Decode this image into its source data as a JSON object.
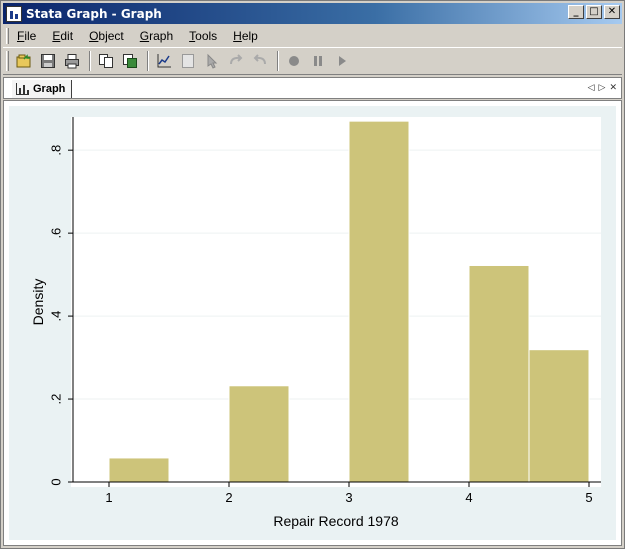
{
  "window": {
    "title": "Stata Graph - Graph",
    "buttons": {
      "minimize": "_",
      "maximize": "□",
      "close": "✕"
    }
  },
  "menu": {
    "items": [
      "File",
      "Edit",
      "Object",
      "Graph",
      "Tools",
      "Help"
    ]
  },
  "toolbar": {
    "icons": [
      "open-icon",
      "save-icon",
      "print-icon",
      "copy-icon",
      "copy-graph-icon",
      "graph-editor-icon",
      "object-browser-icon",
      "pointer-icon",
      "undo-icon",
      "redo-icon",
      "record-icon",
      "pause-icon",
      "play-icon"
    ]
  },
  "tab": {
    "label": "Graph"
  },
  "chart_data": {
    "type": "bar",
    "xlabel": "Repair Record 1978",
    "ylabel": "Density",
    "xlim": [
      0.7,
      5.1
    ],
    "ylim": [
      0,
      0.88
    ],
    "xticks": [
      1,
      2,
      3,
      4,
      5
    ],
    "xtick_labels": [
      "1",
      "2",
      "3",
      "4",
      "5"
    ],
    "yticks": [
      0,
      0.2,
      0.4,
      0.6,
      0.8
    ],
    "ytick_labels": [
      "0",
      ".2",
      ".4",
      ".6",
      ".8"
    ],
    "grid": true,
    "bar_color": "#cdc47a",
    "bars": [
      {
        "x0": 1.0,
        "x1": 1.5,
        "value": 0.058
      },
      {
        "x0": 2.0,
        "x1": 2.5,
        "value": 0.232
      },
      {
        "x0": 3.0,
        "x1": 3.5,
        "value": 0.87
      },
      {
        "x0": 4.0,
        "x1": 4.5,
        "value": 0.522
      },
      {
        "x0": 4.5,
        "x1": 5.0,
        "value": 0.319
      }
    ]
  }
}
